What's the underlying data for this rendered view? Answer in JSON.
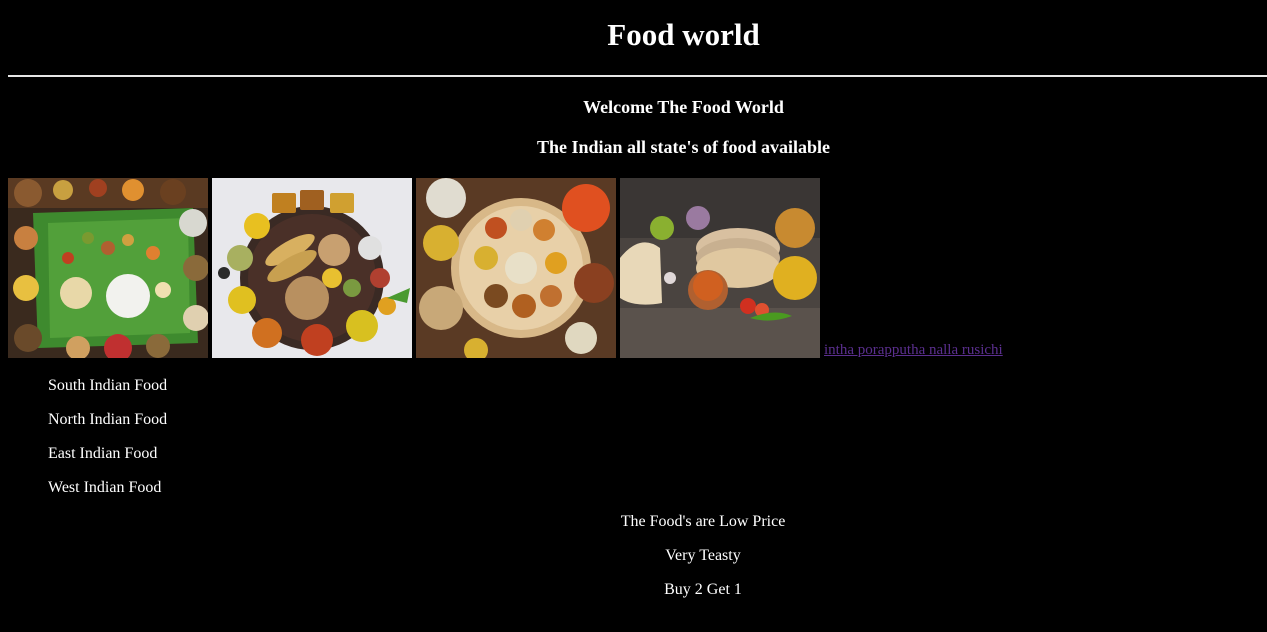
{
  "header": {
    "title": "Food world",
    "welcome": "Welcome The Food World",
    "subtitle": "The Indian all state's of food available"
  },
  "gallery": {
    "images": [
      {
        "alt": "South Indian meal on banana leaf",
        "icon": "banana-leaf-meal-image"
      },
      {
        "alt": "Thali plate with rotis and curries",
        "icon": "thali-plate-image"
      },
      {
        "alt": "Round platter of dishes on wooden table",
        "icon": "platter-image"
      },
      {
        "alt": "Stack of parathas with curries",
        "icon": "paratha-image"
      }
    ],
    "link_text": "intha porapputha nalla rusichi"
  },
  "categories": [
    "South Indian Food",
    "North Indian Food",
    "East Indian Food",
    "West Indian Food"
  ],
  "promo": [
    "The Food's are Low Price",
    "Very Teasty",
    "Buy 2 Get 1"
  ],
  "colors": {
    "background": "#000000",
    "text": "#ffffff",
    "link": "#5b2f8f"
  }
}
